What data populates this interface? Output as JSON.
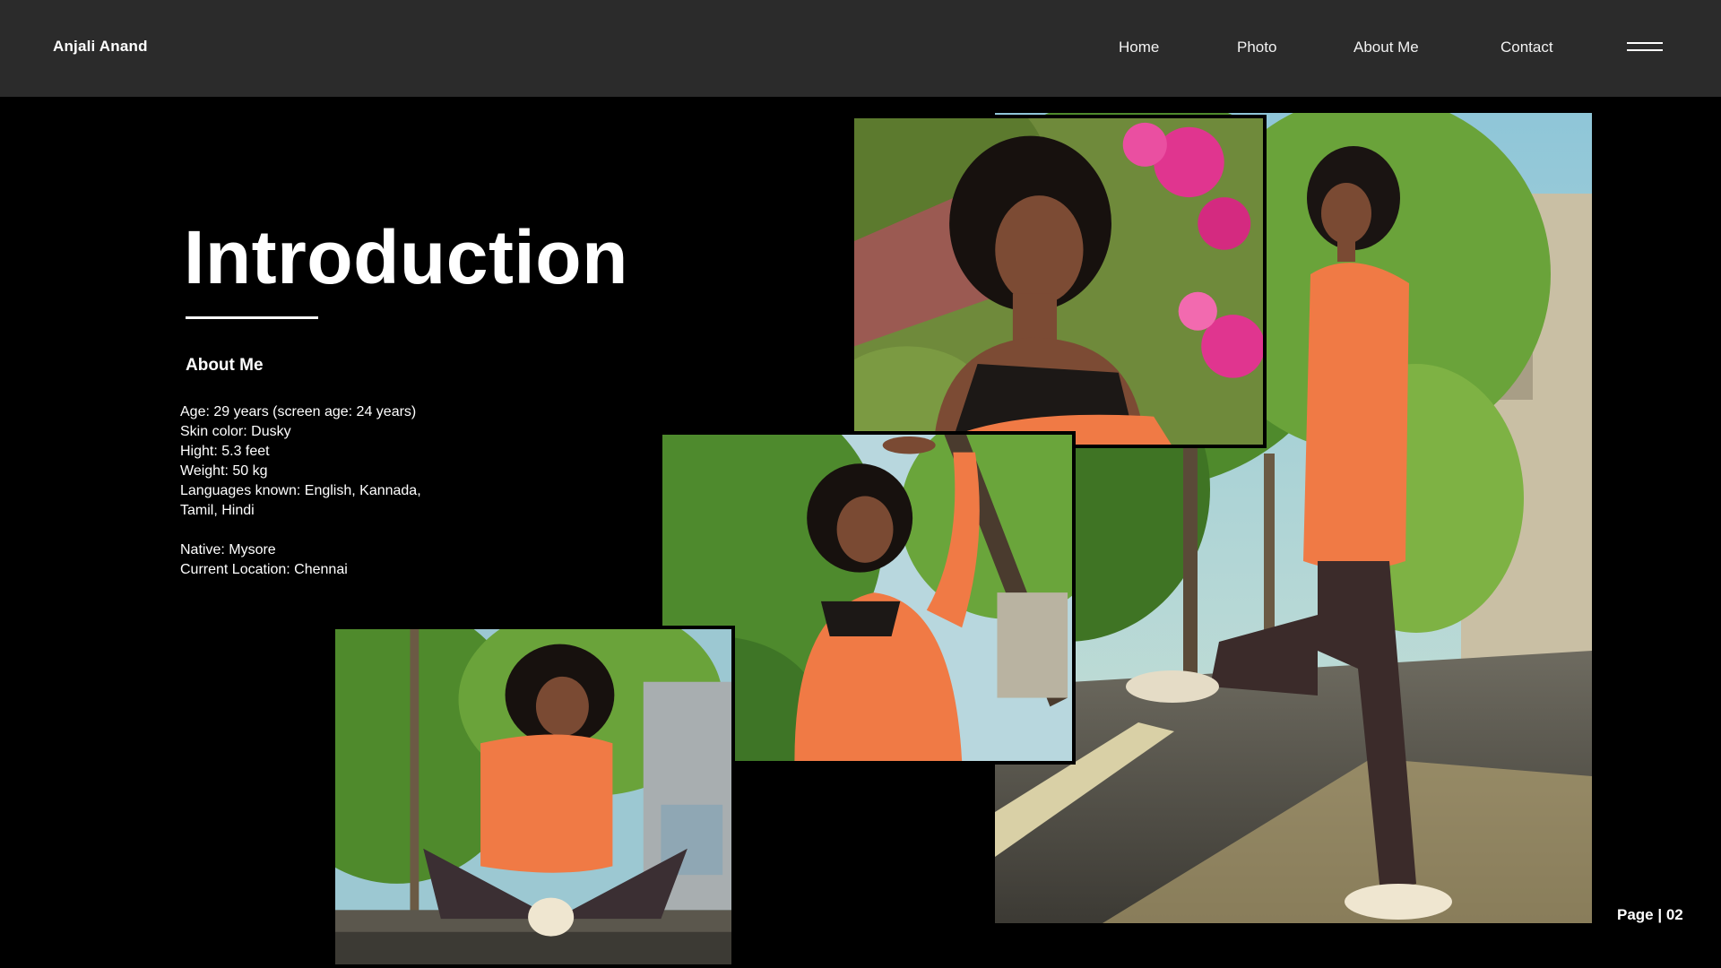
{
  "header": {
    "brand": "Anjali Anand",
    "nav": [
      "Home",
      "Photo",
      "About Me",
      "Contact"
    ],
    "menu_icon": "hamburger-menu-icon"
  },
  "main": {
    "title": "Introduction",
    "subtitle": "About Me",
    "details": {
      "age": "Age: 29 years (screen age: 24 years)",
      "skin": "Skin color: Dusky",
      "height": "Hight: 5.3 feet",
      "weight": "Weight: 50 kg",
      "languages_1": "Languages known: English,  Kannada,",
      "languages_2": "Tamil,  Hindi",
      "native": "Native: Mysore",
      "location": "Current Location: Chennai"
    }
  },
  "footer": {
    "page_label": "Page | 02"
  },
  "colors": {
    "navbar_bg": "#2b2b2b",
    "page_bg": "#000000",
    "sweater_orange": "#f07a45",
    "foliage_green": "#4f8a2c",
    "flower_pink": "#e0358f"
  }
}
